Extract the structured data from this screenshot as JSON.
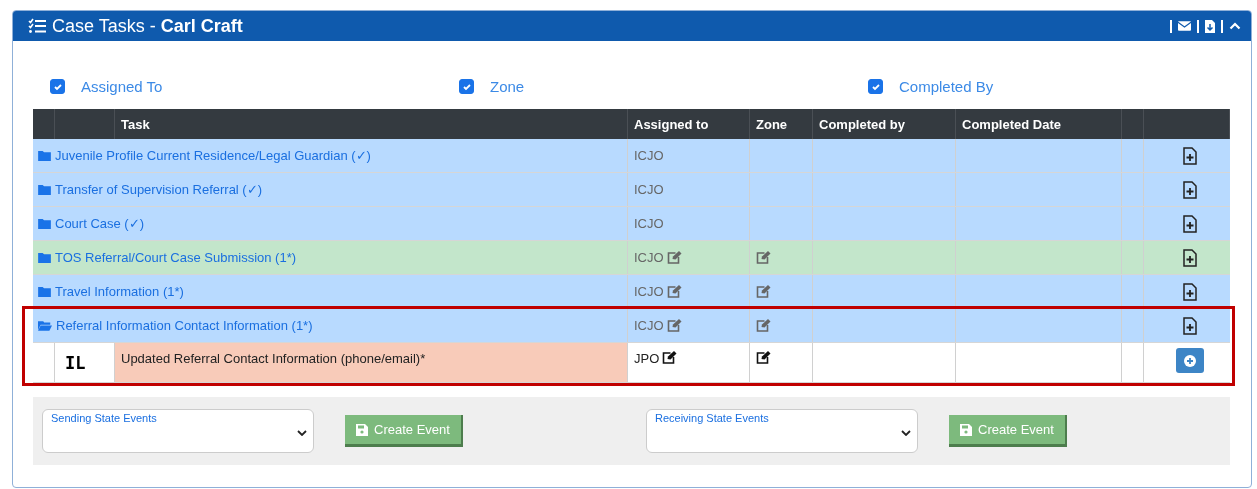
{
  "panel": {
    "title": "Case Tasks - ",
    "title_name": "Carl Craft"
  },
  "filters": [
    {
      "label": "Assigned To",
      "checked": true
    },
    {
      "label": "Zone",
      "checked": true
    },
    {
      "label": "Completed By",
      "checked": true
    }
  ],
  "table": {
    "columns": [
      "Task",
      "Assigned to",
      "Zone",
      "Completed by",
      "Completed Date"
    ],
    "rows": [
      {
        "kind": "group",
        "task": "Juvenile Profile Current Residence/Legal Guardian (✓)",
        "expanded": false,
        "color": "#b8daff",
        "assigned_to": "ICJO",
        "assigned_editable": false,
        "zone_editable": false,
        "highlighted": false
      },
      {
        "kind": "group",
        "task": "Transfer of Supervision Referral (✓)",
        "expanded": false,
        "color": "#b8daff",
        "assigned_to": "ICJO",
        "assigned_editable": false,
        "zone_editable": false,
        "highlighted": false
      },
      {
        "kind": "group",
        "task": "Court Case (✓)",
        "expanded": false,
        "color": "#b8daff",
        "assigned_to": "ICJO",
        "assigned_editable": false,
        "zone_editable": false,
        "highlighted": false
      },
      {
        "kind": "group",
        "task": "TOS Referral/Court Case Submission (1*)",
        "expanded": false,
        "color": "#c3e6cb",
        "assigned_to": "ICJO",
        "assigned_editable": true,
        "zone_editable": true,
        "highlighted": false
      },
      {
        "kind": "group",
        "task": "Travel Information (1*)",
        "expanded": false,
        "color": "#b8daff",
        "assigned_to": "ICJO",
        "assigned_editable": true,
        "zone_editable": true,
        "highlighted": false
      },
      {
        "kind": "group",
        "task": "Referral Information Contact Information (1*)",
        "expanded": true,
        "color": "#b8daff",
        "assigned_to": "ICJO",
        "assigned_editable": true,
        "zone_editable": true,
        "highlighted": true
      },
      {
        "kind": "task",
        "code": "IL",
        "task": "Updated Referral Contact Information (phone/email)*",
        "color": "#f8cbb9",
        "assigned_to": "JPO",
        "assigned_editable": true,
        "zone_editable": true,
        "highlighted": true
      }
    ]
  },
  "events": [
    {
      "label": "Sending State Events",
      "button": "Create Event"
    },
    {
      "label": "Receiving State Events",
      "button": "Create Event"
    }
  ]
}
